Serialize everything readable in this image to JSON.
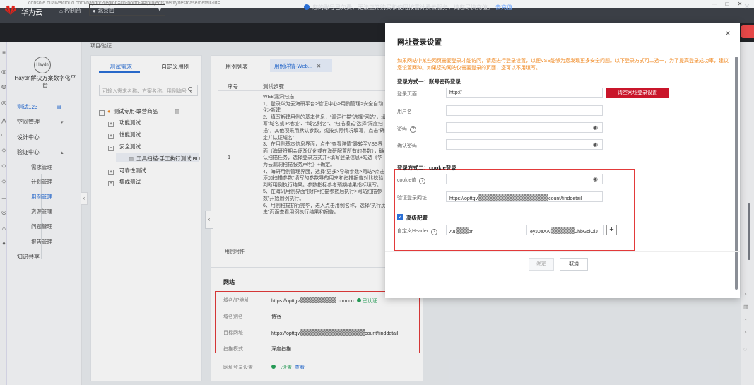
{
  "browser": {
    "url": "console.huaweicloud.com/haydn/?region=cn-north-4#/projects/verify/testcase/detail?id=...",
    "controls": [
      "—",
      "□",
      "✕"
    ]
  },
  "notice": {
    "text": "您的账号已欠费，无法正常购买和使用按需计费云服务，请您尽快充值。",
    "link": "去充值",
    "close": "✕"
  },
  "topnav": {
    "brand": "华为云",
    "console": "控制台",
    "region": "北京四",
    "region_chevron": "▾"
  },
  "service": {
    "logo_text": "Haydn",
    "name": "Haydn解决方案数字化平台"
  },
  "sidebar": {
    "project": "测试123",
    "items": [
      {
        "label": "空间管理",
        "arrow": "▾"
      },
      {
        "label": "设计中心",
        "arrow": ""
      },
      {
        "label": "验证中心",
        "arrow": "▴"
      }
    ],
    "sub_items": [
      "需求管理",
      "计划管理",
      "用例管理",
      "资源管理",
      "问题管理",
      "报告管理"
    ],
    "knowledge": "知识共享",
    "collapse": "‹"
  },
  "crumb": "项目/验证",
  "tree": {
    "tabs": [
      "测试需求",
      "自定义用例"
    ],
    "search_placeholder": "可输入需求名称、方案名称、用例编号",
    "root": "测试专用-联营商品",
    "children": [
      "功能测试",
      "性能测试",
      "安全测试",
      "可靠性测试",
      "集成测试"
    ],
    "leaf": "工具扫描-手工执行测试 BU"
  },
  "detail": {
    "tabs": {
      "list": "用例列表",
      "detail": "用例详情-Web...",
      "close": "✕"
    },
    "columns": {
      "seq": "序号",
      "steps": "测试步骤"
    },
    "row_num": "1",
    "steps": "WEB漏洞扫描\n1、登录华为云海研平台>验证中心>用例管理>安全自动化>新建\n2、填写新建用例的基本信息，“漏洞扫描”选择“网站”，填写“域名或IP地址”、“域名别名”、“扫描模式”选择“深度扫描”，其他项采用默认参数，或按实际情况填写，点击“确定并认证域名”\n3、在用例基本信息界面，点击“查看详情”跳转至VSS界面（海研将期会逐渐优化或在海研配置所有的参数），确认扫描任务，选择登录方式并+填写登录信息+勾选《华为云漏洞扫描服务声明》+确定。\n4、海研用例管理界面，选择“更多>导勒参数>网站>点击添加扫描参数”填写的参数导的用来和扫描报告对比校验判断用例执行结果。参数指标参考预期结果指标填写。\n5、在海研用例界面“操作>扫描参数后执行>网站扫描参数”开始用例执行。\n6、用例扫描执行完毕，进入点击用例名称，选择“执行历史”页面查看用例执行结果和报告。",
    "attachments_label": "用例附件",
    "collapse": "‹"
  },
  "site": {
    "title": "网站",
    "rows": [
      {
        "label": "域名/IP地址",
        "prefix": "https://opttgv",
        "suffix": ".com.cn",
        "status": "已认证"
      },
      {
        "label": "域名别名",
        "value": "博客"
      },
      {
        "label": "目标网址",
        "prefix": "https://opttgv",
        "suffix": "count/finddetail"
      },
      {
        "label": "扫描模式",
        "value": "深度扫描"
      },
      {
        "label": "网址登录设置",
        "status": "已设置",
        "action": "查看"
      }
    ]
  },
  "modal": {
    "title": "网址登录设置",
    "close": "×",
    "tip": "如果网站中某些网页需要登录才能访问，请您进行登录设置，以便VSS能够为您发现更多安全问题。以下登录方式可二选一，为了提高登录成功率，建议您设置两种。如果您的网站仅需要登录的页面，您可以不用填写。",
    "section1": "登录方式一：账号密码登录",
    "login_page_label": "登录页面",
    "login_page_value": "http://",
    "login_cfg_button": "请空网址登录设置",
    "username_label": "用户名",
    "password_label": "密码",
    "confirm_password_label": "确认密码",
    "section2": "登录方式二：cookie登录",
    "cookie_label": "cookie值",
    "verify_url_label": "验证登录网址",
    "verify_url_prefix": "https://opttgv",
    "verify_url_suffix": "count/finddetail",
    "advanced_label": "高级配置",
    "header_label": "自定义Header",
    "header_key_prefix": "Au",
    "header_key_suffix": "on",
    "header_val_prefix": "eyJ0eXAi",
    "header_val_suffix": "JhbGciOiJ",
    "add": "+",
    "ok": "确定",
    "cancel": "取消",
    "check": "✓"
  },
  "icons": {
    "eye": "👁",
    "help": "?",
    "search": "🔍"
  },
  "colors": {
    "accent": "#2a6fd6",
    "danger": "#c9152a",
    "highlight_box": "#e23a3a",
    "warning_text": "#f08a24",
    "success": "#27a35a"
  }
}
